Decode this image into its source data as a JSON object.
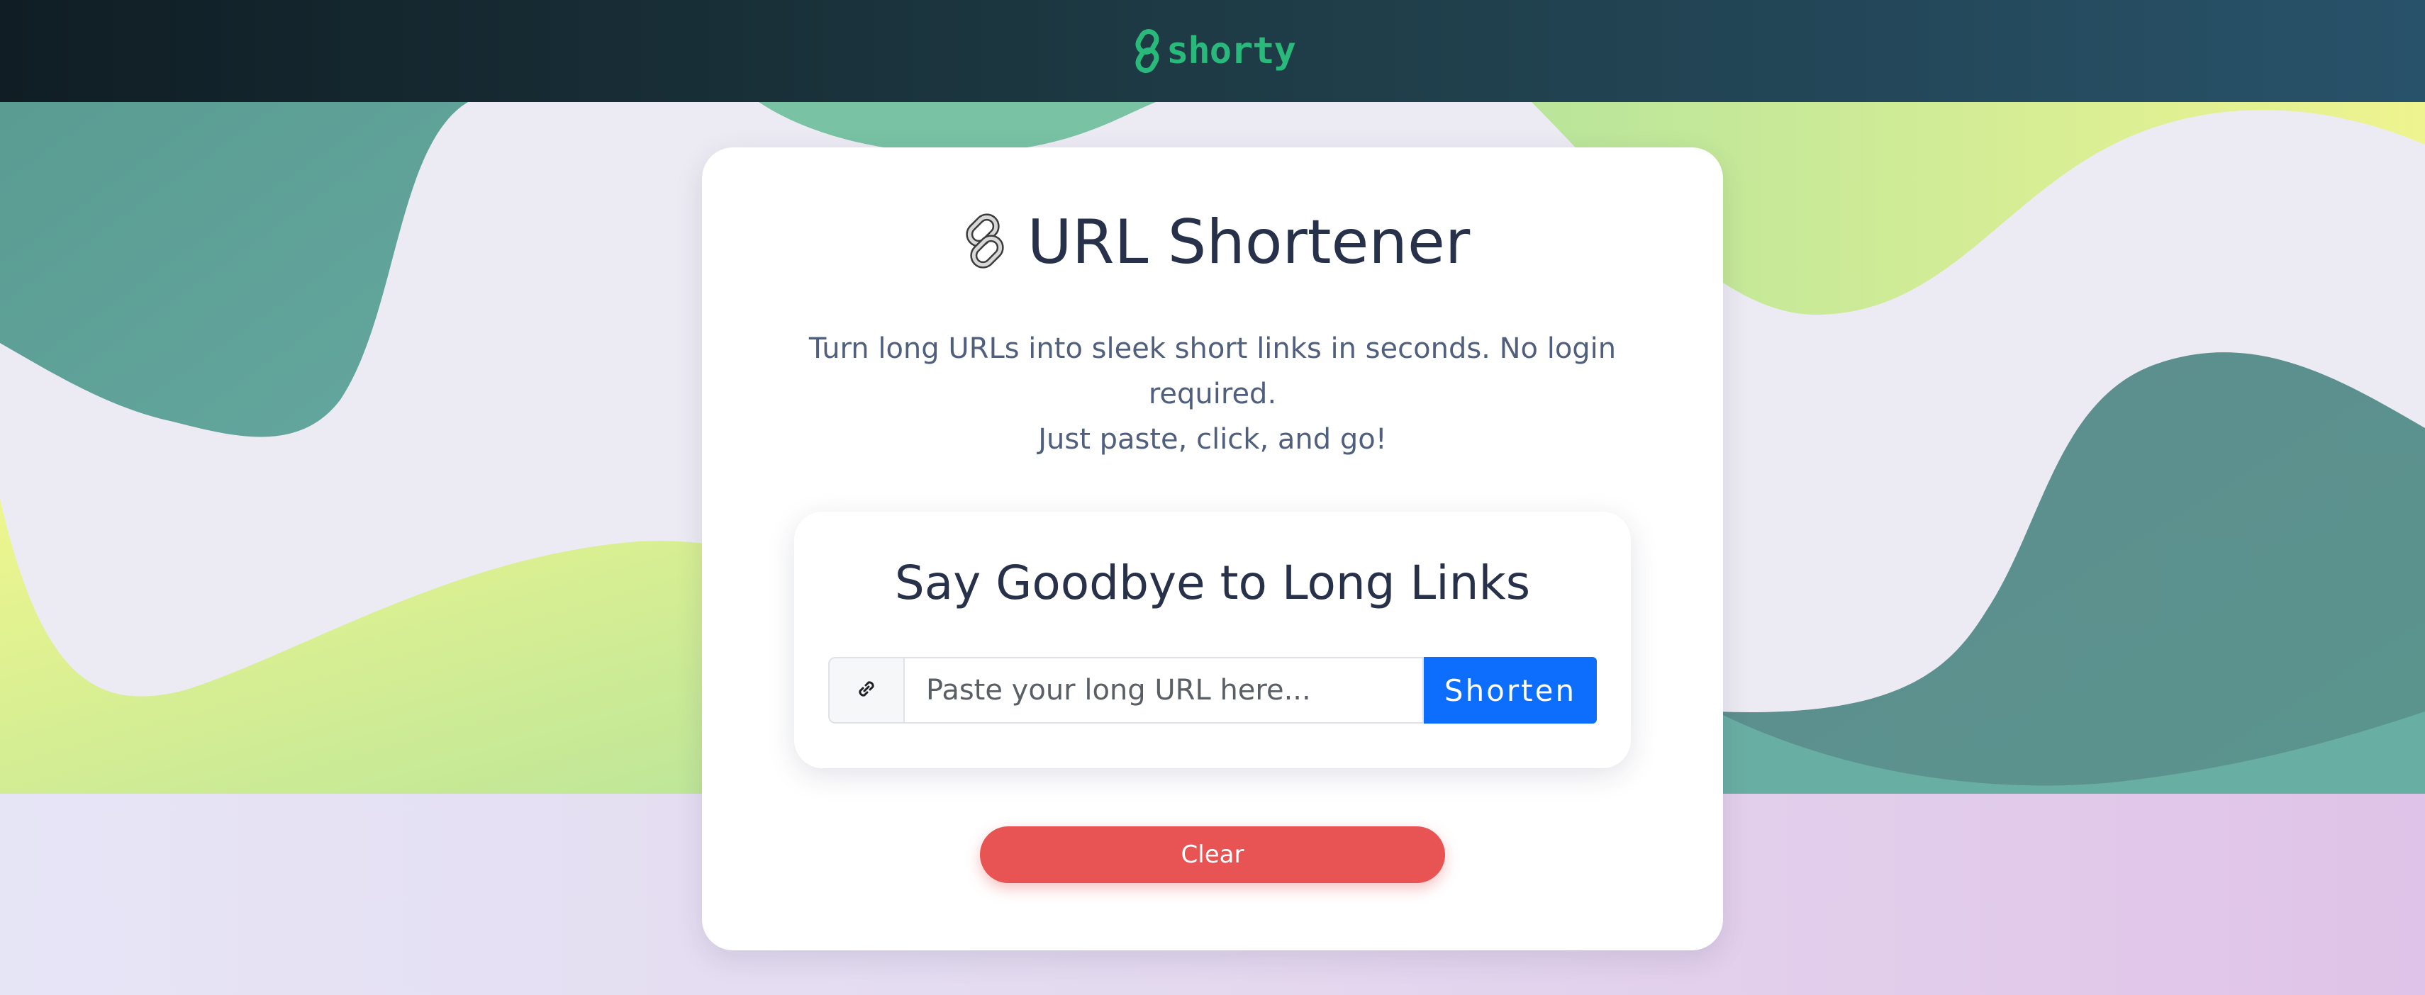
{
  "navbar": {
    "brand_text": "shorty",
    "brand_icon": "chain-link-icon",
    "brand_color": "#29b97a"
  },
  "card": {
    "title_icon": "link-emoji-icon",
    "title": "URL Shortener",
    "subtitle_line1": "Turn long URLs into sleek short links in seconds. No login required.",
    "subtitle_line2": "Just paste, click, and go!"
  },
  "form": {
    "heading": "Say Goodbye to Long Links",
    "input_icon": "link-icon",
    "url_placeholder": "Paste your long URL here...",
    "url_value": "",
    "shorten_label": "Shorten",
    "clear_label": "Clear"
  },
  "colors": {
    "primary_button": "#0d6efd",
    "clear_button": "#e85453",
    "navbar_start": "#101d24",
    "navbar_end": "#28526a",
    "wave_teal": "#5f9e95",
    "wave_lime": "#d4ea98",
    "wave_yellow": "#eaf594"
  }
}
